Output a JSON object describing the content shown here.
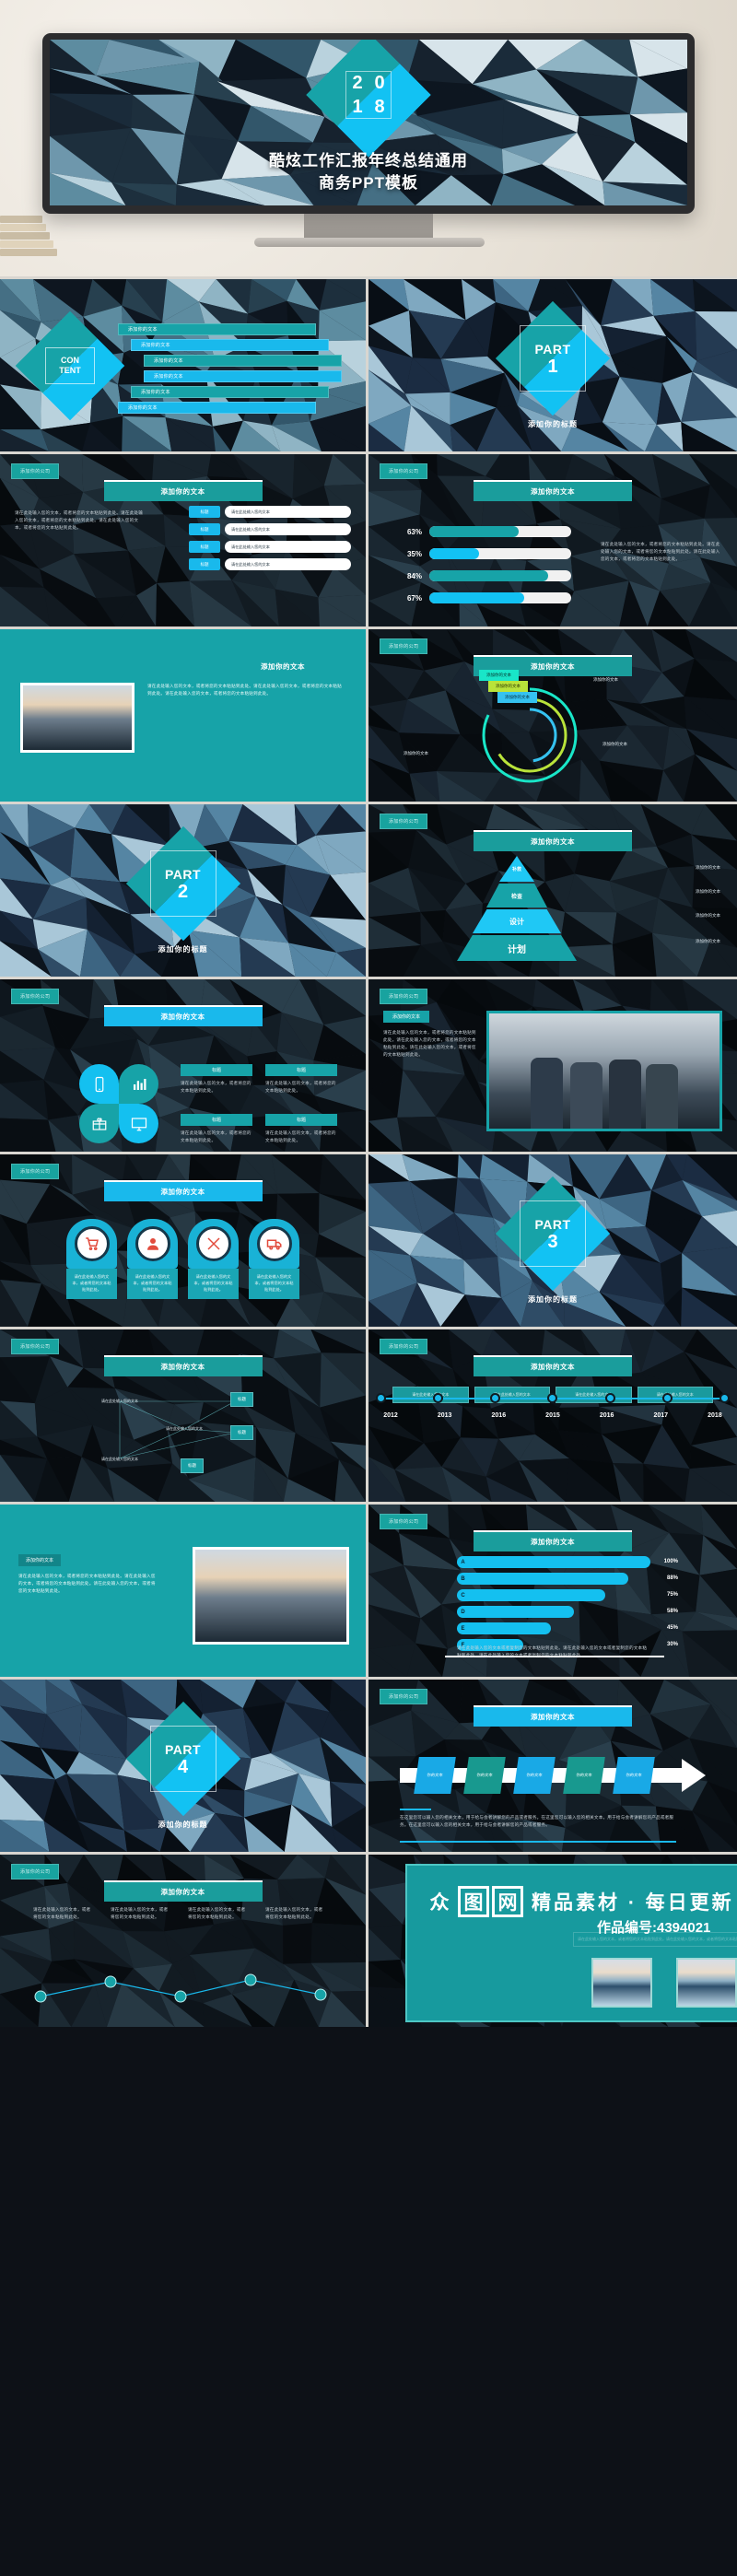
{
  "hero": {
    "year_digits": [
      "2",
      "0",
      "1",
      "8"
    ],
    "title_line1": "酷炫工作汇报年终总结通用",
    "title_line2": "商务PPT模板"
  },
  "common": {
    "tag": "添加你的公司",
    "section_title": "添加你的文本",
    "add_title": "添加你的标题",
    "add_text": "添加你的文本",
    "title_label": "标题",
    "body_short": "请在此处输入您的文本，或者将您的文本粘贴到此处。",
    "body_long": "请在此处输入您的文本，或者将您的文本粘贴到此处。请在此处输入您的文本，或者将您的文本粘贴到此处。请在此处输入您的文本，或者将您的文本粘贴到此处。",
    "body_chart": "请在此处输入您的文本或者复制您的文本粘贴到此处。请在此处输入您的文本或者复制您的文本粘贴到此处。请在此处输入您的文本或者复制您的文本粘贴到此处。",
    "body_arrow": "在这里您可以输入您的相关文本，用于给与会者讲解您的产品或者服务。在这里您可以输入您的相关文本，用于给与会者讲解您的产品或者服务。在这里您可以输入您的相关文本，用于给与会者讲解您的产品或者服务。"
  },
  "slides": {
    "content": {
      "label_line1": "CON",
      "label_line2": "TENT",
      "items": [
        "添加你的文本",
        "添加你的文本",
        "添加你的文本",
        "添加你的文本",
        "添加你的文本",
        "添加你的文本"
      ]
    },
    "part1": {
      "kicker": "PART",
      "number": "1",
      "subtitle": "添加你的标题"
    },
    "part2": {
      "kicker": "PART",
      "number": "2",
      "subtitle": "添加你的标题"
    },
    "part3": {
      "kicker": "PART",
      "number": "3",
      "subtitle": "添加你的标题"
    },
    "part4": {
      "kicker": "PART",
      "number": "4",
      "subtitle": "添加你的标题"
    },
    "bullets": {
      "keys": [
        "标题",
        "标题",
        "标题",
        "标题"
      ],
      "values": [
        "请在此处输入您的文本",
        "请在此处输入您的文本",
        "请在此处输入您的文本",
        "请在此处输入您的文本"
      ]
    },
    "pyramid": {
      "layers": [
        "补救",
        "检查",
        "设计",
        "计划"
      ],
      "notes": [
        "添加你的文本",
        "添加你的文本",
        "添加你的文本",
        "添加你的文本"
      ]
    },
    "icons": {
      "names": [
        "phone-icon",
        "bar-chart-icon",
        "gift-icon",
        "monitor-icon"
      ],
      "cards": [
        {
          "title": "标题",
          "body": "请在此处输入您的文本，或者将您的文本粘贴到此处。"
        },
        {
          "title": "标题",
          "body": "请在此处输入您的文本，或者将您的文本粘贴到此处。"
        },
        {
          "title": "标题",
          "body": "请在此处输入您的文本，或者将您的文本粘贴到此处。"
        },
        {
          "title": "标题",
          "body": "请在此处输入您的文本，或者将您的文本粘贴到此处。"
        }
      ]
    },
    "badges": {
      "icon_names": [
        "shopping-cart-icon",
        "user-icon",
        "tools-icon",
        "delivery-truck-icon"
      ],
      "bodies": [
        "请在此处输入您的文本，或者将您的文本粘贴到此处。",
        "请在此处输入您的文本，或者将您的文本粘贴到此处。",
        "请在此处输入您的文本，或者将您的文本粘贴到此处。",
        "请在此处输入您的文本，或者将您的文本粘贴到此处。"
      ]
    },
    "network": {
      "center": "添加你的文本",
      "nodes": [
        "请在此处输入您的文本",
        "请在此处输入您的文本",
        "请在此处输入您的文本"
      ],
      "boxes": [
        "标题",
        "标题",
        "标题"
      ]
    },
    "arrow": {
      "steps": [
        "你的文本",
        "你的文本",
        "你的文本",
        "你的文本",
        "你的文本"
      ]
    }
  },
  "chart_data": [
    {
      "type": "bar",
      "orientation": "horizontal",
      "title": "添加你的文本",
      "categories": [
        "63%",
        "35%",
        "84%",
        "67%"
      ],
      "values": [
        63,
        35,
        84,
        67
      ],
      "colors": [
        "#17a3a8",
        "#12c2f3",
        "#17a3a8",
        "#12c2f3"
      ],
      "xlabel": "",
      "ylabel": "",
      "ylim": [
        0,
        100
      ],
      "note": "请在此处输入您的文本，或者将您的文本粘贴到此处。请在此处输入您的文本，或者将您的文本粘贴到此处。请在此处输入您的文本，或者将您的文本粘贴到此处。"
    },
    {
      "type": "pie",
      "subtype": "radial-progress",
      "title": "添加你的文本",
      "categories": [
        "添加你的文本",
        "添加你的文本",
        "添加你的文本"
      ],
      "values": [
        82,
        66,
        48
      ],
      "colors": [
        "#19e6c8",
        "#b9e33a",
        "#35c2f0"
      ],
      "annotations": [
        "添加你的文本",
        "添加你的文本",
        "添加你的文本"
      ]
    },
    {
      "type": "bar",
      "orientation": "horizontal",
      "title": "添加你的文本",
      "categories": [
        "A",
        "B",
        "C",
        "D",
        "E",
        "F"
      ],
      "values": [
        100,
        88,
        75,
        58,
        45,
        30
      ],
      "value_labels": [
        "100%",
        "88%",
        "75%",
        "58%",
        "45%",
        "30%"
      ],
      "color": "#14c0f0",
      "xlabel": "",
      "ylabel": "",
      "xlim": [
        0,
        100
      ],
      "grid": true
    },
    {
      "type": "line",
      "subtype": "timeline",
      "title": "添加你的文本",
      "categories": [
        "2012",
        "2013",
        "2016",
        "2015",
        "2016",
        "2017",
        "2018"
      ],
      "values": [
        1,
        1,
        1,
        1,
        1,
        1,
        1
      ],
      "annotations": [
        "请在此处输入您的文本",
        "请在此处输入您的文本",
        "请在此处输入您的文本",
        "请在此处输入您的文本"
      ]
    }
  ],
  "watermark": {
    "logo_chars": [
      "众",
      "图",
      "网"
    ],
    "slogan": "精品素材 · 每日更新",
    "code": "作品编号:4394021"
  }
}
